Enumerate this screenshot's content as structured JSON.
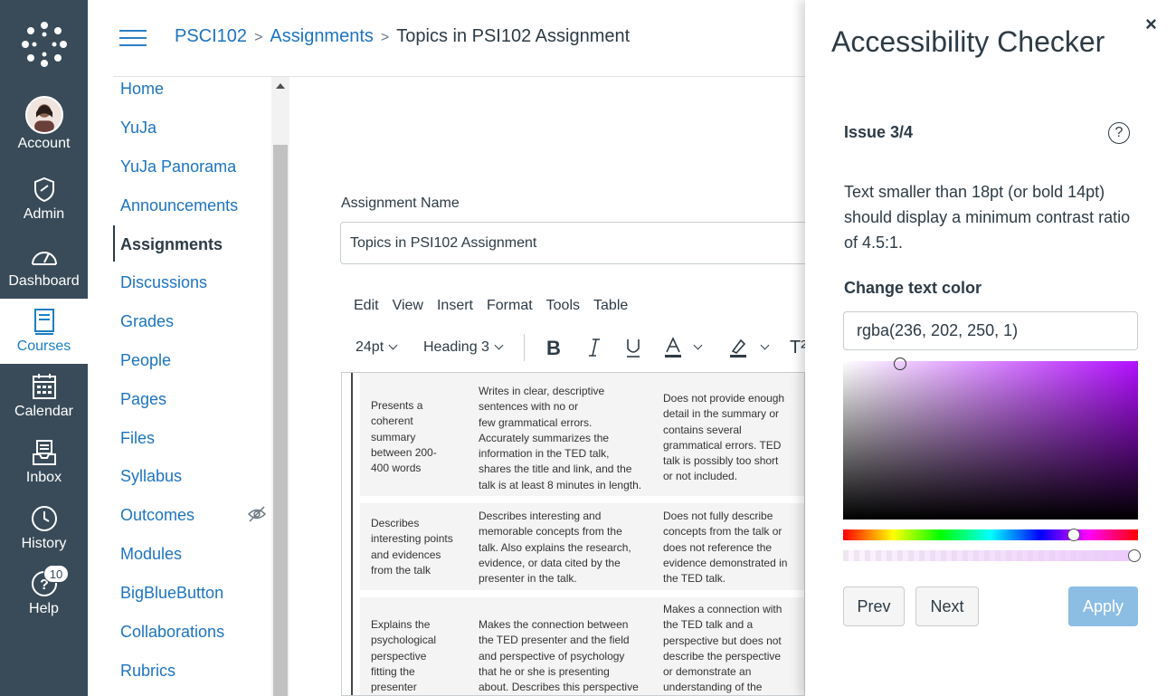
{
  "global_nav": {
    "items": [
      {
        "label": "Account",
        "icon": "avatar"
      },
      {
        "label": "Admin",
        "icon": "shield-icon"
      },
      {
        "label": "Dashboard",
        "icon": "dashboard-icon"
      },
      {
        "label": "Courses",
        "icon": "book-icon"
      },
      {
        "label": "Calendar",
        "icon": "calendar-icon"
      },
      {
        "label": "Inbox",
        "icon": "inbox-icon"
      },
      {
        "label": "History",
        "icon": "clock-icon"
      },
      {
        "label": "Help",
        "icon": "help-icon"
      }
    ],
    "help_badge": "10",
    "active": "Courses"
  },
  "breadcrumb": {
    "course": "PSCI102",
    "section": "Assignments",
    "current": "Topics in PSI102 Assignment"
  },
  "course_nav": {
    "items": [
      "Home",
      "YuJa",
      "YuJa Panorama",
      "Announcements",
      "Assignments",
      "Discussions",
      "Grades",
      "People",
      "Pages",
      "Files",
      "Syllabus",
      "Outcomes",
      "Modules",
      "BigBlueButton",
      "Collaborations",
      "Rubrics"
    ],
    "active": "Assignments"
  },
  "form": {
    "name_label": "Assignment Name",
    "name_value": "Topics in PSI102 Assignment"
  },
  "editor": {
    "menu": [
      "Edit",
      "View",
      "Insert",
      "Format",
      "Tools",
      "Table"
    ],
    "font_size": "24pt",
    "block_style": "Heading 3",
    "superscript_partial": "T²",
    "rows": [
      {
        "c1": [
          "Presents a",
          "coherent",
          "summary",
          "between 200-",
          "400 words"
        ],
        "c2": [
          "Writes in clear, descriptive",
          "sentences with no or",
          "few grammatical errors.",
          "Accurately summarizes the",
          "information in the TED talk,",
          "shares the title and link, and the",
          "talk is at least 8 minutes in length."
        ],
        "c3": [
          "Does not provide enough",
          "detail in the summary or",
          "contains several",
          "grammatical errors. TED",
          "talk is possibly too short",
          "or not included."
        ]
      },
      {
        "c1": [
          "Describes",
          "interesting points",
          "and evidences",
          "from the talk"
        ],
        "c2": [
          "Describes interesting and",
          "memorable concepts from the",
          "talk. Also explains the research,",
          "evidence, or data cited by the",
          "presenter in the talk."
        ],
        "c3": [
          "Does not fully describe",
          "concepts from the talk or",
          "does not reference the",
          "evidence demonstrated in",
          "the TED talk."
        ]
      },
      {
        "c1": [
          "Explains the",
          "psychological",
          "perspective",
          "fitting the",
          "presenter"
        ],
        "c2": [
          "Makes the connection between",
          "the TED presenter and the field",
          "and perspective of psychology",
          "that he or she is presenting",
          "about. Describes this perspective"
        ],
        "c3": [
          "Makes a connection with",
          "the TED talk and a",
          "perspective but does not",
          "describe the perspective",
          "or demonstrate an",
          "understanding of the"
        ]
      }
    ]
  },
  "a11y": {
    "title": "Accessibility Checker",
    "close": "×",
    "issue": "Issue 3/4",
    "help": "?",
    "message": "Text smaller than 18pt (or bold 14pt) should display a minimum contrast ratio of 4.5:1.",
    "color_label": "Change text color",
    "color_value": "rgba(236, 202, 250, 1)",
    "prev": "Prev",
    "next": "Next",
    "apply": "Apply"
  },
  "colors": {
    "nav_bg": "#394b58",
    "link": "#1d74c0",
    "apply": "#8cbde3"
  }
}
